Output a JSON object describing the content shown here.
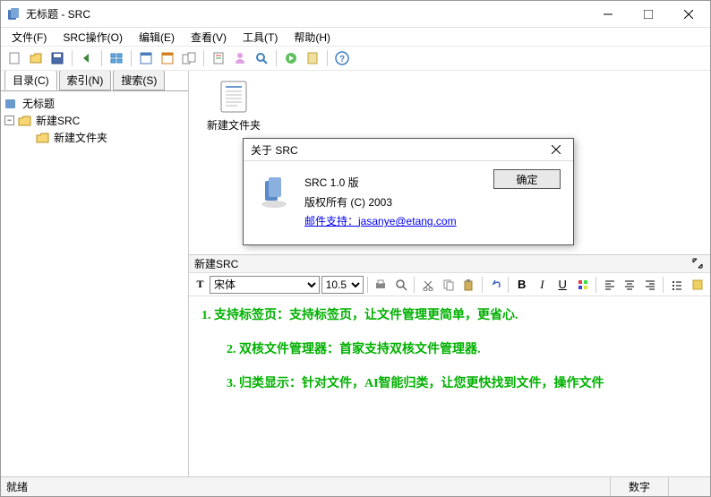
{
  "titlebar": {
    "title": "无标题 - SRC"
  },
  "menubar": {
    "items": [
      "文件(F)",
      "SRC操作(O)",
      "编辑(E)",
      "查看(V)",
      "工具(T)",
      "帮助(H)"
    ]
  },
  "sidebar": {
    "tabs": [
      "目录(C)",
      "索引(N)",
      "搜索(S)"
    ],
    "tree": {
      "root": "无标题",
      "child1": "新建SRC",
      "child2": "新建文件夹"
    }
  },
  "filepane": {
    "item1": "新建文件夹"
  },
  "about": {
    "title": "关于 SRC",
    "line1": "SRC 1.0 版",
    "line2": "版权所有 (C) 2003",
    "support_label": "邮件支持：",
    "support_email": "jasanye@etang.com",
    "ok": "确定"
  },
  "editor": {
    "header": "新建SRC",
    "font_name": "宋体",
    "font_size": "10.5",
    "lines": {
      "l1": "1. 支持标签页：支持标签页，让文件管理更简单，更省心.",
      "l2": "2. 双核文件管理器：首家支持双核文件管理器.",
      "l3": "3. 归类显示：针对文件，AI智能归类，让您更快找到文件，操作文件"
    }
  },
  "status": {
    "ready": "就绪",
    "mode": "数字"
  }
}
